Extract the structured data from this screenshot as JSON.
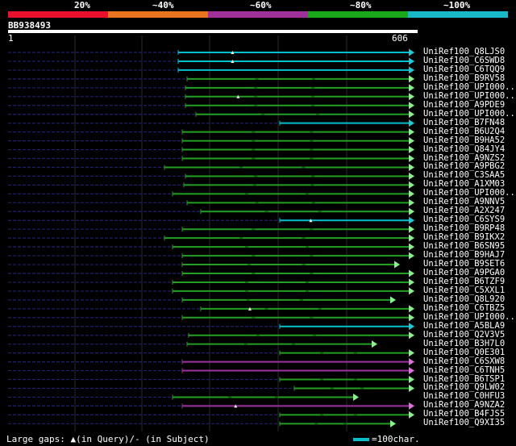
{
  "scale": {
    "segments": [
      {
        "color": "#e8102a"
      },
      {
        "color": "#e87420"
      },
      {
        "color": "#a0309a"
      },
      {
        "color": "#1aa81a"
      },
      {
        "color": "#18b8c8"
      }
    ],
    "labels": [
      "20%",
      "~40%",
      "~60%",
      "~80%",
      "~100%"
    ]
  },
  "query": {
    "id": "BB938493",
    "start": "1",
    "end": "606"
  },
  "colors": {
    "cyan": "#00c0d0",
    "green": "#22a022",
    "magenta": "#a030a0",
    "arrow_cyan": "#20c8d8",
    "arrow_green": "#8cf08c",
    "arrow_magenta": "#e070e0"
  },
  "hits": [
    {
      "label": "UniRef100_Q8LJS0",
      "color": "cyan",
      "start": 221,
      "end": 514,
      "gap": "yes"
    },
    {
      "label": "UniRef100_C6SWD8",
      "color": "cyan",
      "start": 221,
      "end": 514,
      "gap": "yes"
    },
    {
      "label": "UniRef100_C6TQQ9",
      "color": "cyan",
      "start": 221,
      "end": 514,
      "gap": "no"
    },
    {
      "label": "UniRef100_B9RV58",
      "color": "green",
      "start": 232,
      "end": 514,
      "gap": "no"
    },
    {
      "label": "UniRef100_UPI000..",
      "color": "green",
      "start": 230,
      "end": 514,
      "gap": "no"
    },
    {
      "label": "UniRef100_UPI000..",
      "color": "green",
      "start": 230,
      "end": 514,
      "gap": "yes"
    },
    {
      "label": "UniRef100_A9PDE9",
      "color": "green",
      "start": 230,
      "end": 514,
      "gap": "no"
    },
    {
      "label": "UniRef100_UPI000..",
      "color": "green",
      "start": 243,
      "end": 514,
      "gap": "no"
    },
    {
      "label": "UniRef100_B7FN48",
      "color": "cyan",
      "start": 347,
      "end": 514,
      "gap": "no"
    },
    {
      "label": "UniRef100_B6U2Q4",
      "color": "green",
      "start": 226,
      "end": 514,
      "gap": "no"
    },
    {
      "label": "UniRef100_B9HA52",
      "color": "green",
      "start": 226,
      "end": 514,
      "gap": "no"
    },
    {
      "label": "UniRef100_Q84JY4",
      "color": "green",
      "start": 226,
      "end": 514,
      "gap": "no"
    },
    {
      "label": "UniRef100_A9NZS2",
      "color": "green",
      "start": 226,
      "end": 514,
      "gap": "no"
    },
    {
      "label": "UniRef100_A9PBG2",
      "color": "green",
      "start": 204,
      "end": 514,
      "gap": "no"
    },
    {
      "label": "UniRef100_C3SAA5",
      "color": "green",
      "start": 230,
      "end": 514,
      "gap": "no"
    },
    {
      "label": "UniRef100_A1XM03",
      "color": "green",
      "start": 228,
      "end": 514,
      "gap": "no"
    },
    {
      "label": "UniRef100_UPI000..",
      "color": "green",
      "start": 214,
      "end": 514,
      "gap": "no"
    },
    {
      "label": "UniRef100_A9NNV5",
      "color": "green",
      "start": 232,
      "end": 514,
      "gap": "no"
    },
    {
      "label": "UniRef100_A2X247",
      "color": "green",
      "start": 249,
      "end": 514,
      "gap": "no"
    },
    {
      "label": "UniRef100_C6SYS9",
      "color": "cyan",
      "start": 347,
      "end": 514,
      "gap": "yes"
    },
    {
      "label": "UniRef100_B9RP48",
      "color": "green",
      "start": 226,
      "end": 514,
      "gap": "no"
    },
    {
      "label": "UniRef100_B9IKX2",
      "color": "green",
      "start": 204,
      "end": 514,
      "gap": "no"
    },
    {
      "label": "UniRef100_B6SN95",
      "color": "green",
      "start": 214,
      "end": 514,
      "gap": "no"
    },
    {
      "label": "UniRef100_B9HAJ7",
      "color": "green",
      "start": 226,
      "end": 514,
      "gap": "no"
    },
    {
      "label": "UniRef100_B9SET6",
      "color": "green",
      "start": 226,
      "end": 496,
      "gap": "no"
    },
    {
      "label": "UniRef100_A9PGA0",
      "color": "green",
      "start": 226,
      "end": 514,
      "gap": "no"
    },
    {
      "label": "UniRef100_B6TZF9",
      "color": "green",
      "start": 214,
      "end": 514,
      "gap": "no"
    },
    {
      "label": "UniRef100_C5XXL1",
      "color": "green",
      "start": 214,
      "end": 514,
      "gap": "no"
    },
    {
      "label": "UniRef100_Q8L920",
      "color": "green",
      "start": 226,
      "end": 491,
      "gap": "no"
    },
    {
      "label": "UniRef100_C6TBZ5",
      "color": "green",
      "start": 249,
      "end": 514,
      "gap": "yes"
    },
    {
      "label": "UniRef100_UPI000..",
      "color": "green",
      "start": 226,
      "end": 514,
      "gap": "no"
    },
    {
      "label": "UniRef100_A5BLA9",
      "color": "cyan",
      "start": 347,
      "end": 514,
      "gap": "no"
    },
    {
      "label": "UniRef100_Q2V3V5",
      "color": "green",
      "start": 234,
      "end": 514,
      "gap": "no"
    },
    {
      "label": "UniRef100_B3H7L0",
      "color": "green",
      "start": 232,
      "end": 468,
      "gap": "no"
    },
    {
      "label": "UniRef100_Q0E301",
      "color": "green",
      "start": 347,
      "end": 514,
      "gap": "no"
    },
    {
      "label": "UniRef100_C6SXW8",
      "color": "magenta",
      "start": 226,
      "end": 514,
      "gap": "no"
    },
    {
      "label": "UniRef100_C6TNH5",
      "color": "magenta",
      "start": 226,
      "end": 514,
      "gap": "no"
    },
    {
      "label": "UniRef100_B6TSP1",
      "color": "green",
      "start": 347,
      "end": 514,
      "gap": "no"
    },
    {
      "label": "UniRef100_Q9LW02",
      "color": "green",
      "start": 365,
      "end": 514,
      "gap": "no"
    },
    {
      "label": "UniRef100_C0HFU3",
      "color": "green",
      "start": 214,
      "end": 445,
      "gap": "no"
    },
    {
      "label": "UniRef100_A9NZA2",
      "color": "magenta",
      "start": 226,
      "end": 514,
      "gap": "yes"
    },
    {
      "label": "UniRef100_B4FJS5",
      "color": "green",
      "start": 347,
      "end": 514,
      "gap": "no"
    },
    {
      "label": "UniRef100_Q9XI35",
      "color": "green",
      "start": 347,
      "end": 491,
      "gap": "no"
    }
  ],
  "legend": {
    "left_text": "Large gaps: ▲(in Query)/- (in Subject)",
    "right_text": "=100char."
  }
}
